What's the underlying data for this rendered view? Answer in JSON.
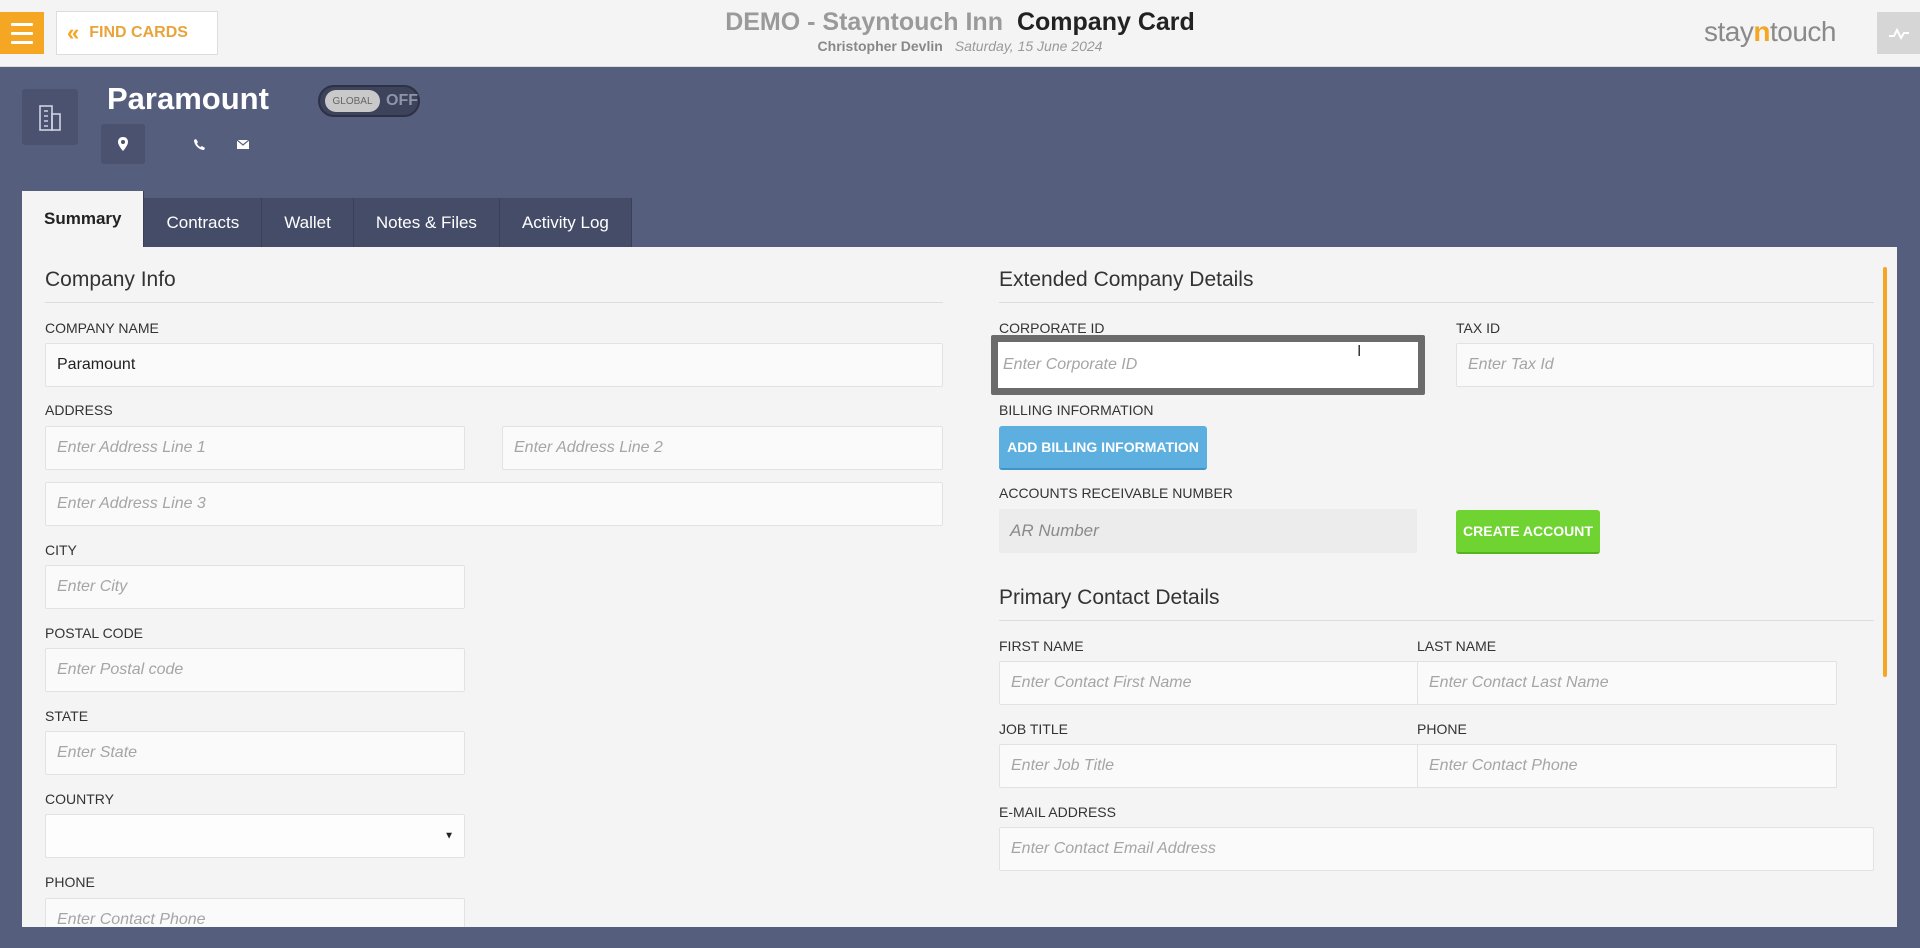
{
  "header": {
    "find_cards_label": "FIND CARDS",
    "hotel_name": "DEMO - Stayntouch Inn",
    "page_title": "Company Card",
    "user_name": "Christopher Devlin",
    "date": "Saturday, 15 June 2024",
    "logo_pre": "stay",
    "logo_n": "n",
    "logo_post": "touch"
  },
  "company": {
    "name": "Paramount",
    "global_label": "GLOBAL",
    "global_state": "OFF"
  },
  "tabs": [
    {
      "label": "Summary",
      "active": true
    },
    {
      "label": "Contracts"
    },
    {
      "label": "Wallet"
    },
    {
      "label": "Notes & Files"
    },
    {
      "label": "Activity Log"
    }
  ],
  "company_info": {
    "title": "Company Info",
    "company_name_label": "COMPANY NAME",
    "company_name_value": "Paramount",
    "address_label": "ADDRESS",
    "address_line1_ph": "Enter Address Line 1",
    "address_line2_ph": "Enter Address Line 2",
    "address_line3_ph": "Enter Address Line 3",
    "city_label": "CITY",
    "city_ph": "Enter City",
    "postal_label": "POSTAL CODE",
    "postal_ph": "Enter Postal code",
    "state_label": "STATE",
    "state_ph": "Enter State",
    "country_label": "COUNTRY",
    "country_value": "",
    "phone_label": "PHONE",
    "phone_ph": "Enter Contact Phone"
  },
  "extended": {
    "title": "Extended Company Details",
    "corporate_id_label": "CORPORATE ID",
    "corporate_id_ph": "Enter Corporate ID",
    "tax_id_label": "TAX ID",
    "tax_id_ph": "Enter Tax Id",
    "billing_label": "BILLING INFORMATION",
    "billing_button": "ADD BILLING INFORMATION",
    "ar_label": "ACCOUNTS RECEIVABLE NUMBER",
    "ar_ph": "AR Number",
    "create_account_button": "CREATE ACCOUNT"
  },
  "primary_contact": {
    "title": "Primary Contact Details",
    "first_name_label": "FIRST NAME",
    "first_name_ph": "Enter Contact First Name",
    "last_name_label": "LAST NAME",
    "last_name_ph": "Enter Contact Last Name",
    "job_title_label": "JOB TITLE",
    "job_title_ph": "Enter Job Title",
    "phone_label": "PHONE",
    "phone_ph": "Enter Contact Phone",
    "email_label": "E-MAIL ADDRESS",
    "email_ph": "Enter Contact Email Address"
  },
  "colors": {
    "accent": "#f5a623",
    "background": "#565e7d",
    "button_blue": "#5dafe0",
    "button_green": "#6fd331"
  }
}
